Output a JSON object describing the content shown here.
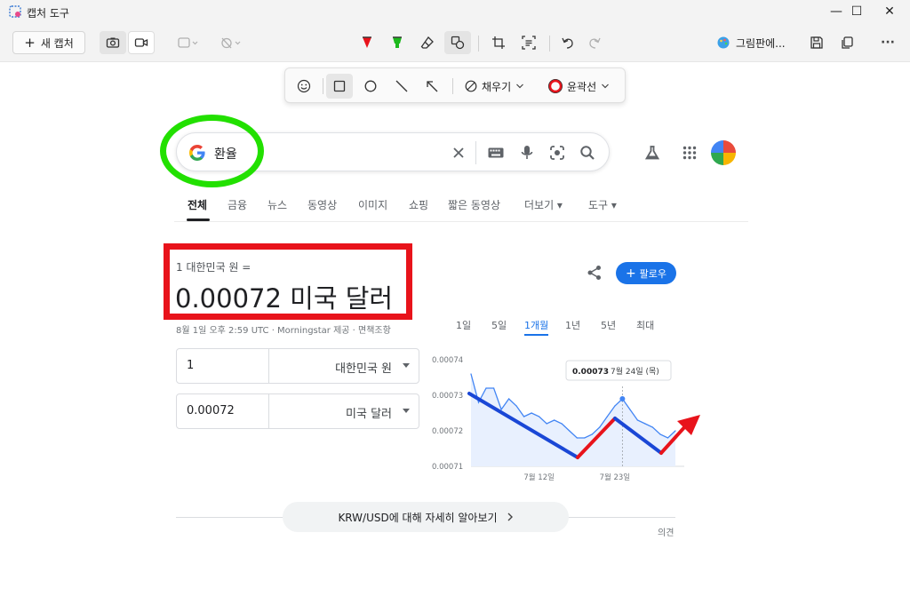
{
  "window": {
    "title": "캡처 도구",
    "minimize": "—",
    "maximize": "☐",
    "close": "✕"
  },
  "toolbar": {
    "new_capture": "새 캡처",
    "new_capture_plus": "+",
    "paint_label": "그림판에...",
    "more": "···"
  },
  "shape_bar": {
    "fill_label": "채우기",
    "outline_label": "윤곽선"
  },
  "search": {
    "query": "환율"
  },
  "tabs": [
    "전체",
    "금융",
    "뉴스",
    "동영상",
    "이미지",
    "쇼핑",
    "짧은 동영상",
    "더보기 ▾",
    "도구 ▾"
  ],
  "converter": {
    "from_text": "1 대한민국 원 =",
    "to_text": "0.00072 미국 달러",
    "meta": "8월 1일 오후 2:59 UTC · Morningstar 제공 · 면책조항",
    "follow_label": "팔로우",
    "field1_value": "1",
    "field1_currency": "대한민국 원",
    "field2_value": "0.00072",
    "field2_currency": "미국 달러"
  },
  "ranges": [
    "1일",
    "5일",
    "1개월",
    "1년",
    "5년",
    "최대"
  ],
  "chart_data": {
    "type": "line",
    "y_ticks": [
      "0.00074",
      "0.00073",
      "0.00072",
      "0.00071"
    ],
    "ylim": [
      0.00071,
      0.00074
    ],
    "x_tick_labels": [
      "7월 12일",
      "7월 23일"
    ],
    "values": [
      0.000736,
      0.000728,
      0.000732,
      0.000732,
      0.000726,
      0.000729,
      0.000727,
      0.000724,
      0.000725,
      0.000724,
      0.000722,
      0.000723,
      0.000722,
      0.00072,
      0.000718,
      0.000718,
      0.000719,
      0.000721,
      0.000724,
      0.000727,
      0.000729,
      0.000726,
      0.000723,
      0.000722,
      0.000721,
      0.000719,
      0.000718,
      0.00072
    ],
    "tooltip_value": "0.00073",
    "tooltip_date": "7월 24일 (목)",
    "line_color": "#4285f4"
  },
  "learn_more": "KRW/USD에 대해 자세히 알아보기",
  "feedback": "의견"
}
